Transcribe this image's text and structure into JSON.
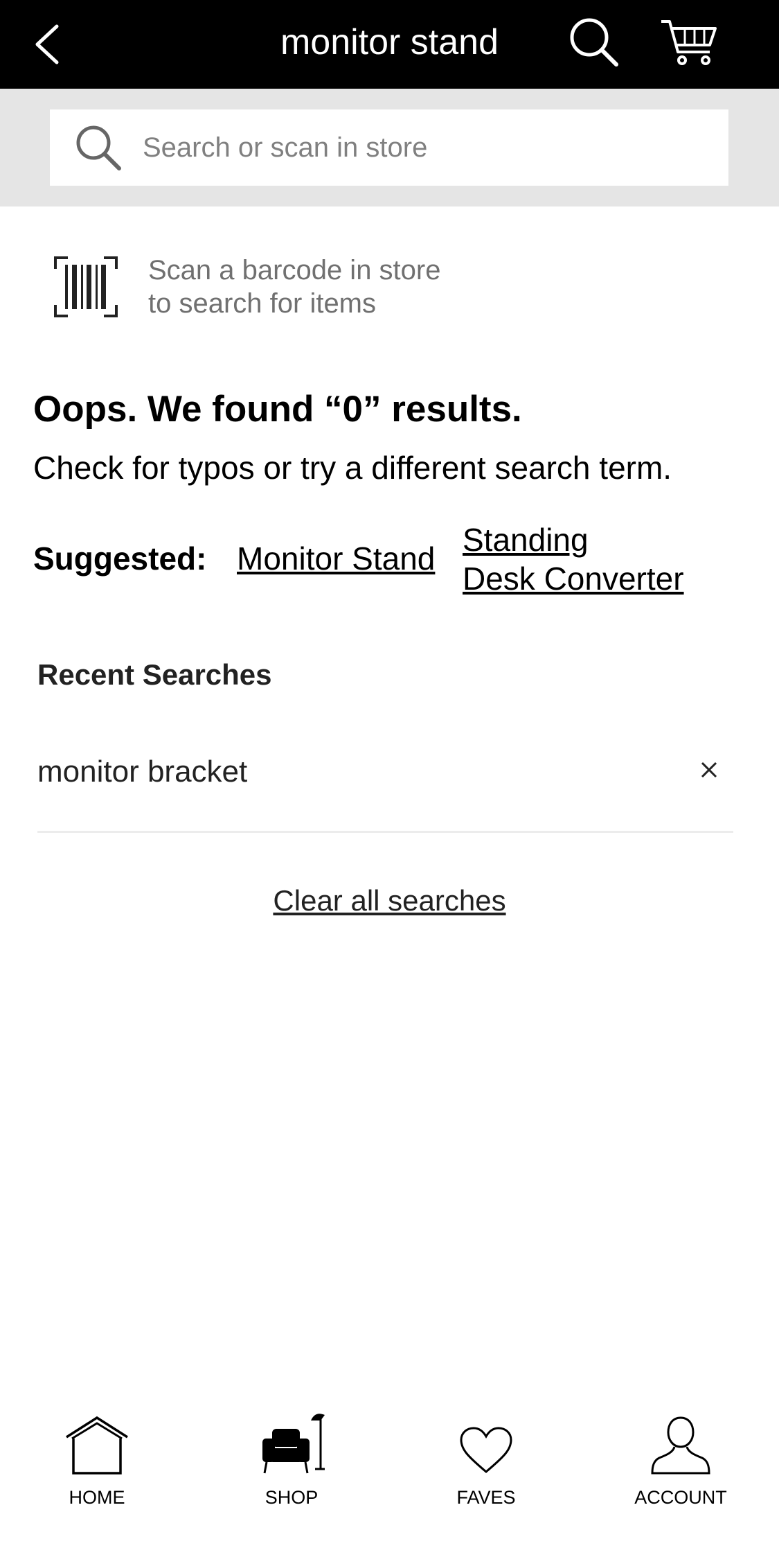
{
  "header": {
    "title": "monitor stand",
    "back_icon": "chevron-left-icon",
    "search_icon": "search-icon",
    "cart_icon": "cart-icon",
    "background": "#000000"
  },
  "search": {
    "placeholder": "Search or scan in store",
    "value": ""
  },
  "scan": {
    "line1": "Scan a barcode in store",
    "line2": "to search for items",
    "icon": "barcode-icon"
  },
  "results": {
    "heading": "Oops. We found “0” results.",
    "hint": "Check for typos or try a different search term."
  },
  "suggested": {
    "label": "Suggested:",
    "links": [
      "Monitor Stand",
      "Standing",
      "Desk Converter"
    ]
  },
  "recent": {
    "title": "Recent Searches",
    "items": [
      "monitor bracket"
    ],
    "remove_icon": "close-icon",
    "clear_label": "Clear all searches"
  },
  "bottom_nav": {
    "items": [
      {
        "label": "HOME",
        "icon": "home-icon"
      },
      {
        "label": "SHOP",
        "icon": "armchair-lamp-icon"
      },
      {
        "label": "FAVES",
        "icon": "heart-icon"
      },
      {
        "label": "ACCOUNT",
        "icon": "user-icon"
      }
    ]
  }
}
